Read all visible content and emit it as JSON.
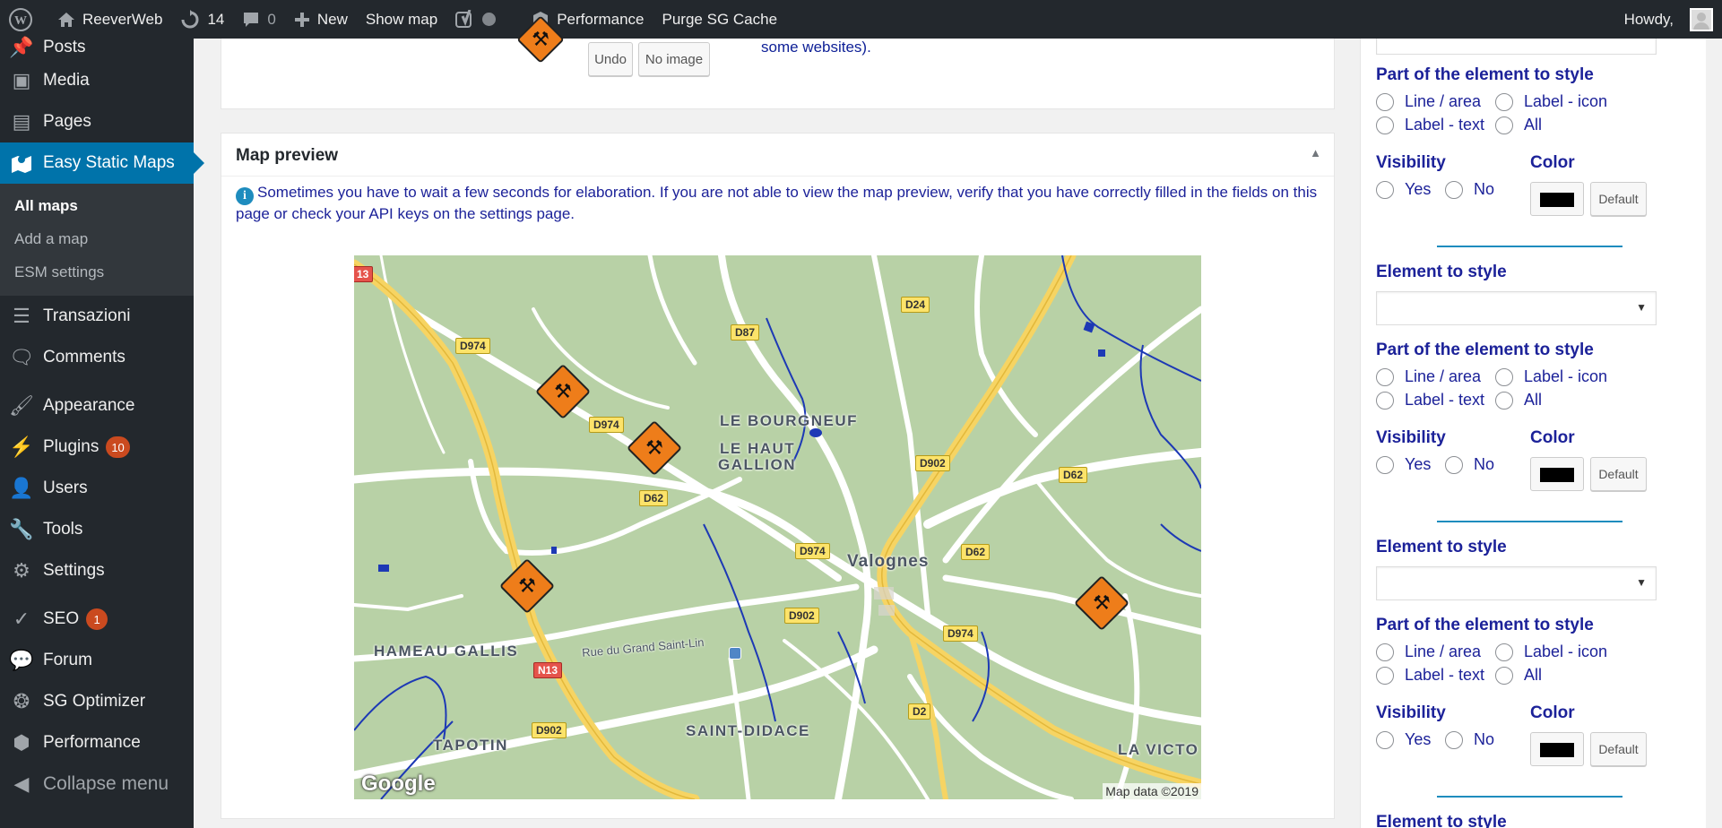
{
  "adminbar": {
    "site_name": "ReeverWeb",
    "updates_count": "14",
    "comments_count": "0",
    "new_label": "New",
    "show_map_label": "Show map",
    "performance_label": "Performance",
    "purge_label": "Purge SG Cache",
    "howdy_label": "Howdy,"
  },
  "sidebar": {
    "items_top": [
      {
        "label": "Posts",
        "icon": "pushpin-icon"
      },
      {
        "label": "Media",
        "icon": "media-icon"
      },
      {
        "label": "Pages",
        "icon": "pages-icon"
      }
    ],
    "active": {
      "label": "Easy Static Maps",
      "icon": "map-icon"
    },
    "submenu": [
      "All maps",
      "Add a map",
      "ESM settings"
    ],
    "items_mid": [
      {
        "label": "Transazioni",
        "icon": "stack-icon"
      },
      {
        "label": "Comments",
        "icon": "comment-icon"
      }
    ],
    "items_bottom": [
      {
        "label": "Appearance",
        "icon": "brush-icon"
      },
      {
        "label": "Plugins",
        "icon": "plug-icon",
        "badge": "10"
      },
      {
        "label": "Users",
        "icon": "user-icon"
      },
      {
        "label": "Tools",
        "icon": "wrench-icon"
      },
      {
        "label": "Settings",
        "icon": "sliders-icon"
      }
    ],
    "items_extra": [
      {
        "label": "SEO",
        "icon": "yoast-icon",
        "badge": "1"
      },
      {
        "label": "Forum",
        "icon": "forum-icon"
      },
      {
        "label": "SG Optimizer",
        "icon": "sg-icon"
      },
      {
        "label": "Performance",
        "icon": "perf-icon"
      }
    ],
    "collapse_label": "Collapse menu"
  },
  "top_box": {
    "undo_label": "Undo",
    "no_image_label": "No image",
    "note_text": "some websites)."
  },
  "map_preview": {
    "title": "Map preview",
    "info_text": "Sometimes you have to wait a few seconds for elaboration. If you are not able to view the map preview, verify that you have correctly filled in the fields on this page or check your API keys on the settings page.",
    "map": {
      "places": [
        "LE BOURGNEUF",
        "LE HAUT",
        "GALLION",
        "Valognes",
        "HAMEAU GALLIS",
        "SAINT-DIDACE",
        "TAPOTIN",
        "LA VICTO",
        "Rue du Grand Saint-Lin"
      ],
      "roads": [
        "D974",
        "D974",
        "D87",
        "D24",
        "D62",
        "D902",
        "D62",
        "D974",
        "D62",
        "D902",
        "D974",
        "D2",
        "D902",
        "N13",
        "13"
      ],
      "credit": "Map data ©2019",
      "logo": "Google"
    }
  },
  "right_panel": {
    "part_title": "Part of the element to style",
    "element_title": "Element to style",
    "line_area": "Line / area",
    "label_icon": "Label - icon",
    "label_text": "Label - text",
    "all": "All",
    "visibility": "Visibility",
    "color": "Color",
    "yes": "Yes",
    "no": "No",
    "default_btn": "Default",
    "swatch_color": "#000000"
  }
}
